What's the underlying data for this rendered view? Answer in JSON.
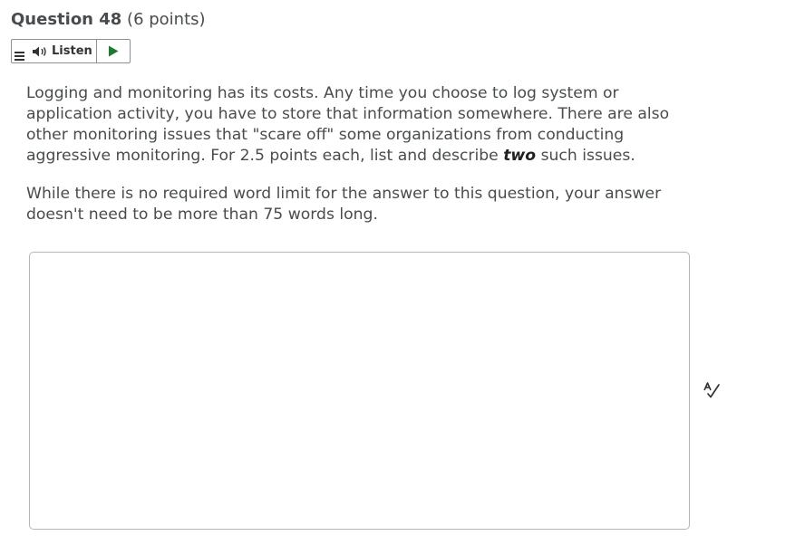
{
  "question": {
    "title": "Question 48",
    "points": "(6 points)"
  },
  "listen_widget": {
    "menu_icon": "menu-lines-icon",
    "speaker_icon": "speaker-icon",
    "listen_label": "Listen",
    "play_icon": "play-icon",
    "play_color": "#1e7a2e"
  },
  "prompt": {
    "paragraph1_before": "Logging and monitoring has its costs. Any time you choose to log system or application activity, you have to store that information somewhere. There are also other monitoring issues that \"scare off\" some organizations from conducting aggressive monitoring.  For 2.5 points each, list and describe ",
    "paragraph1_emphasis": "two",
    "paragraph1_after": " such issues.",
    "paragraph2": "While there is no required word limit for the answer to this question, your answer doesn't need to be more than 75 words long."
  },
  "answer": {
    "value": "",
    "spellcheck_icon": "spellcheck-icon"
  }
}
